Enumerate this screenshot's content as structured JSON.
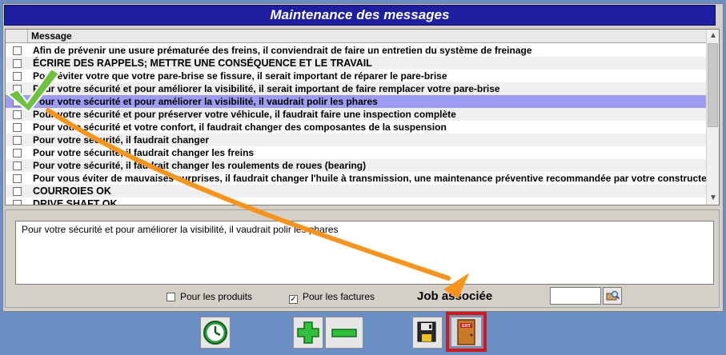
{
  "window": {
    "title": "Maintenance des messages"
  },
  "list": {
    "header": "Message",
    "rows": [
      {
        "text": "Afin de prévenir une usure prématurée des freins, il conviendrait de faire un entretien du système de freinage",
        "checked": false
      },
      {
        "text": "ÉCRIRE DES RAPPELS; METTRE UNE CONSÉQUENCE ET LE TRAVAIL",
        "checked": false
      },
      {
        "text": "Pour éviter votre que votre pare-brise se fissure, il serait important de réparer le pare-brise",
        "checked": false
      },
      {
        "text": "Pour votre sécurité et pour améliorer la visibilité, il serait important de faire remplacer votre pare-brise",
        "checked": false
      },
      {
        "text": "Pour votre sécurité et pour améliorer la visibilité, il vaudrait polir les phares",
        "checked": true,
        "selected": true
      },
      {
        "text": "Pour votre sécurité et pour préserver votre véhicule, il faudrait faire une inspection complète",
        "checked": false
      },
      {
        "text": "Pour votre sécurité et votre confort, il faudrait changer des composantes de la suspension",
        "checked": false
      },
      {
        "text": "Pour votre sécurité, il faudrait changer",
        "checked": false
      },
      {
        "text": "Pour votre sécurité, il faudrait changer les freins",
        "checked": false
      },
      {
        "text": "Pour votre sécurité, il faudrait changer les roulements de roues (bearing)",
        "checked": false
      },
      {
        "text": "Pour vous éviter de mauvaises surprises, il faudrait changer l'huile à transmission, une maintenance préventive recommandée par votre constructeur",
        "checked": false
      },
      {
        "text": "COURROIES OK",
        "checked": false
      },
      {
        "text": "DRIVE SHAFT OK",
        "checked": false
      }
    ]
  },
  "detail": {
    "text": "Pour votre sécurité et pour améliorer la visibilité, il vaudrait polir les phares"
  },
  "options": {
    "products_label": "Pour les produits",
    "products_checked": false,
    "invoices_label": "Pour les factures",
    "invoices_checked": true,
    "job_label": "Job associée",
    "job_value": ""
  },
  "toolbar": {
    "icons": [
      "clock-icon",
      "plus-icon",
      "minus-icon",
      "save-icon",
      "exit-door-icon"
    ],
    "exit_label": "EXIT"
  },
  "colors": {
    "title_bar": "#1e1ea0",
    "selected_row": "#9c9cf2",
    "annotation_arrow": "#f7941d",
    "annotation_check": "#6fc23f",
    "exit_highlight": "#d01818"
  }
}
